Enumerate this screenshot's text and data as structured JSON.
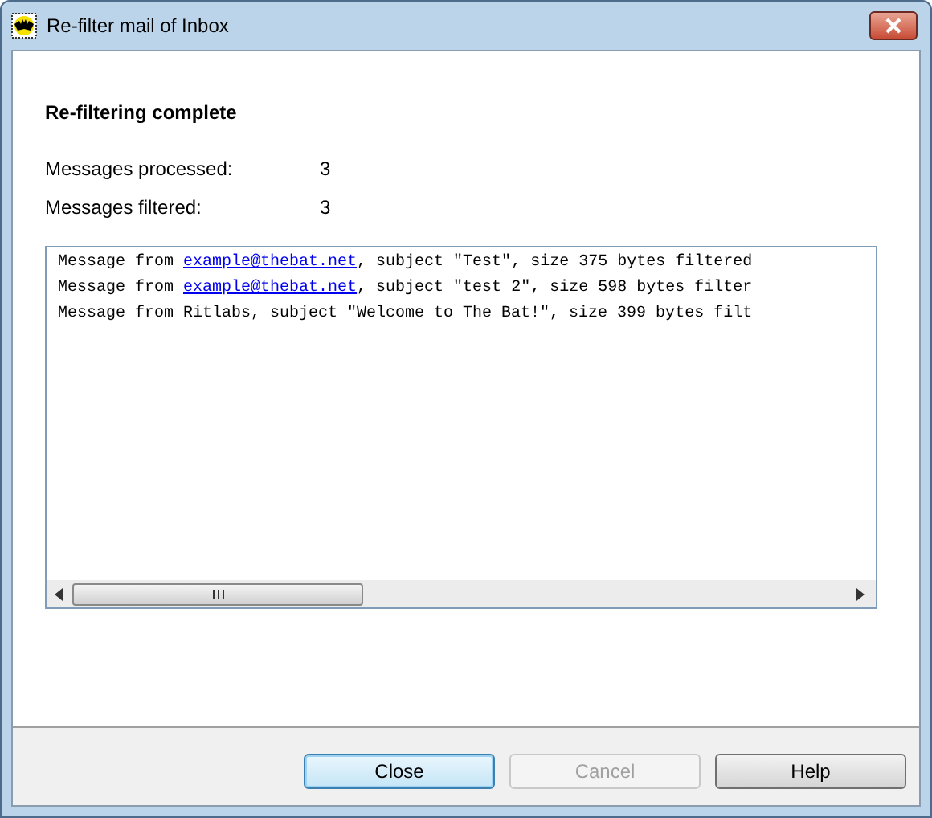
{
  "window": {
    "title": "Re-filter mail of Inbox"
  },
  "heading": "Re-filtering complete",
  "stats": [
    {
      "label": "Messages processed:",
      "value": "3"
    },
    {
      "label": "Messages filtered:",
      "value": "3"
    }
  ],
  "log": [
    {
      "segments": [
        {
          "kind": "text",
          "text": "Message from "
        },
        {
          "kind": "link",
          "text": "example@thebat.net"
        },
        {
          "kind": "text",
          "text": ", subject \"Test\", size 375 bytes filtered"
        }
      ]
    },
    {
      "segments": [
        {
          "kind": "text",
          "text": "Message from "
        },
        {
          "kind": "link",
          "text": "example@thebat.net"
        },
        {
          "kind": "text",
          "text": ", subject \"test 2\", size 598 bytes filter"
        }
      ]
    },
    {
      "segments": [
        {
          "kind": "text",
          "text": "Message from Ritlabs, subject \"Welcome to The Bat!\", size 399 bytes filt"
        }
      ]
    }
  ],
  "buttons": [
    {
      "label": "Close",
      "default": true,
      "disabled": false
    },
    {
      "label": "Cancel",
      "default": false,
      "disabled": true
    },
    {
      "label": "Help",
      "default": false,
      "disabled": false
    }
  ]
}
